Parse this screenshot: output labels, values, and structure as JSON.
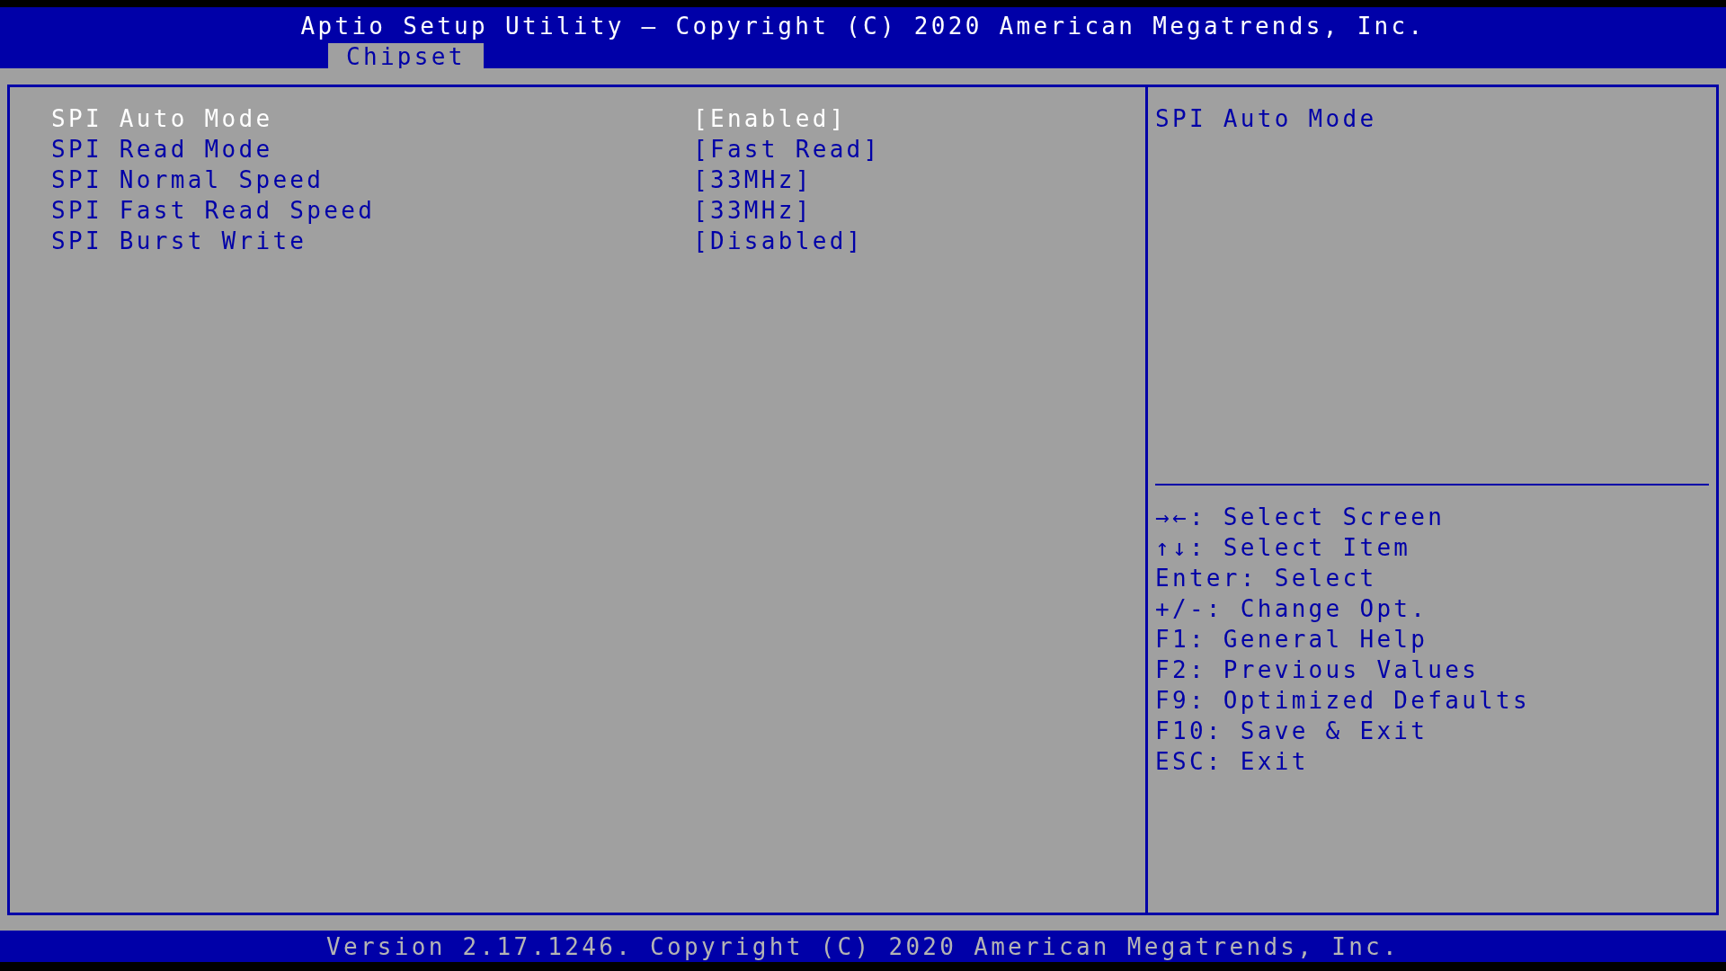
{
  "title": "Aptio Setup Utility – Copyright (C) 2020 American Megatrends, Inc.",
  "tabs": [
    {
      "label": "Chipset",
      "selected": true
    }
  ],
  "items": [
    {
      "label": "SPI Auto Mode",
      "value": "[Enabled]",
      "selected": true
    },
    {
      "label": "SPI Read Mode",
      "value": "[Fast Read]",
      "selected": false
    },
    {
      "label": "SPI Normal Speed",
      "value": "[33MHz]",
      "selected": false
    },
    {
      "label": "SPI Fast Read Speed",
      "value": "[33MHz]",
      "selected": false
    },
    {
      "label": "SPI Burst Write",
      "value": "[Disabled]",
      "selected": false
    }
  ],
  "help_text": "SPI Auto Mode",
  "key_help": [
    "→←: Select Screen",
    "↑↓: Select Item",
    "Enter: Select",
    "+/-: Change Opt.",
    "F1: General Help",
    "F2: Previous Values",
    "F9: Optimized Defaults",
    "F10: Save & Exit",
    "ESC: Exit"
  ],
  "footer": "Version 2.17.1246. Copyright (C) 2020 American Megatrends, Inc."
}
